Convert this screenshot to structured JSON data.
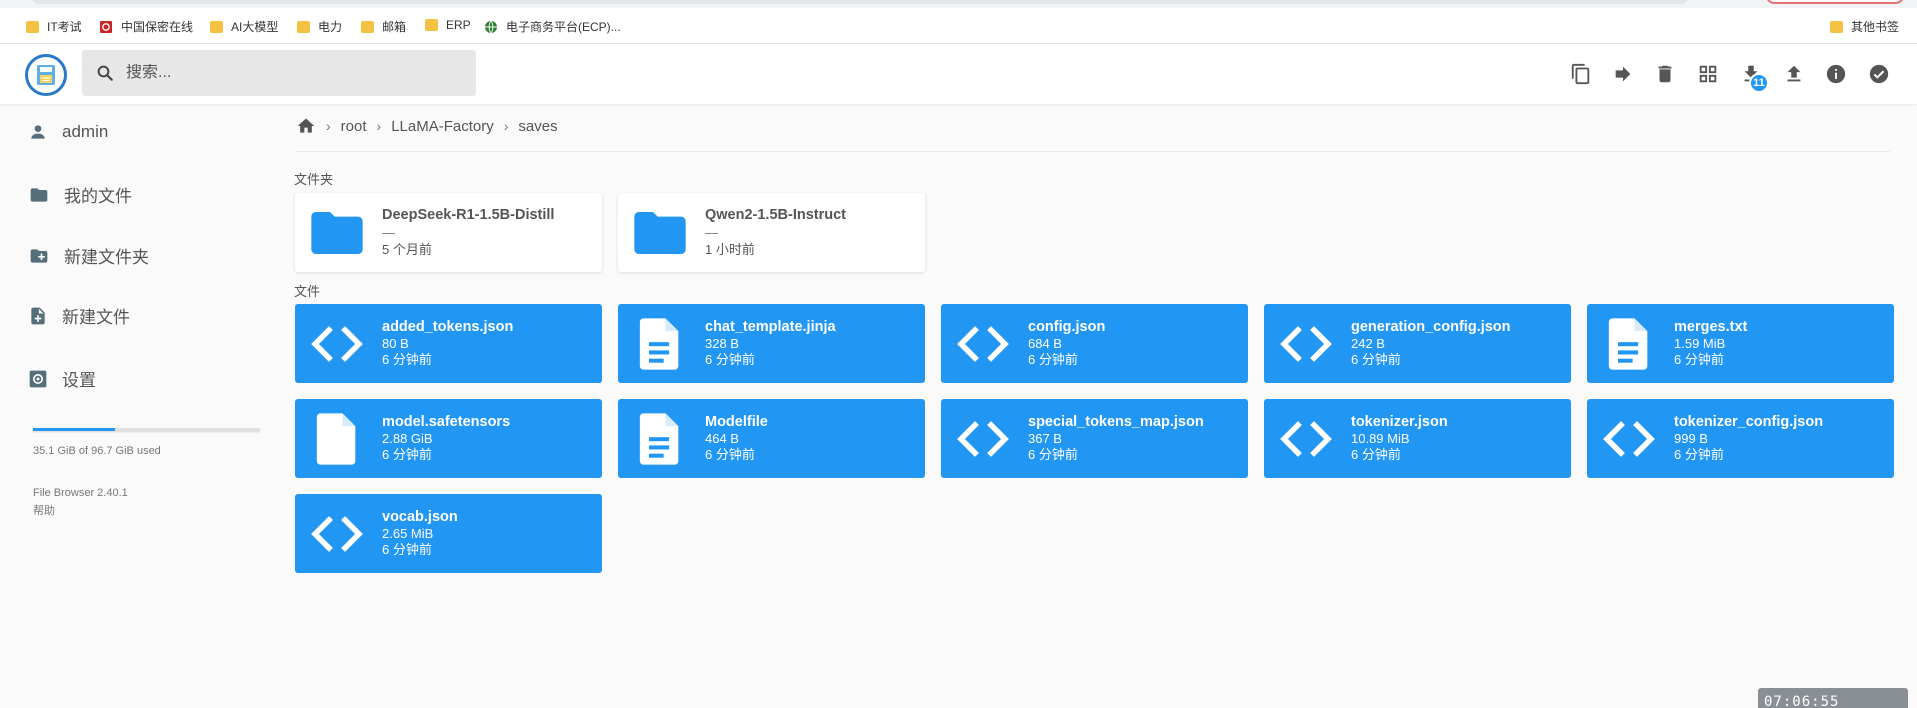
{
  "bookmarks": {
    "items": [
      {
        "label": "IT考试",
        "icon": "folder-icon"
      },
      {
        "label": "中国保密在线",
        "icon": "site-icon"
      },
      {
        "label": "AI大模型",
        "icon": "folder-icon"
      },
      {
        "label": "电力",
        "icon": "folder-icon"
      },
      {
        "label": "邮箱",
        "icon": "folder-icon"
      },
      {
        "label": "ERP",
        "icon": "folder-icon"
      },
      {
        "label": "电子商务平台(ECP)...",
        "icon": "globe-icon"
      }
    ],
    "other": "其他书签"
  },
  "header": {
    "search_placeholder": "搜索...",
    "download_badge": "11",
    "accent": "#2196f3"
  },
  "sidebar": {
    "user": "admin",
    "my_files": "我的文件",
    "new_folder": "新建文件夹",
    "new_file": "新建文件",
    "settings": "设置",
    "usage_text": "35.1 GiB of 96.7 GiB used",
    "usage_fraction": 0.363,
    "version": "File Browser 2.40.1",
    "help": "帮助"
  },
  "breadcrumb": [
    "root",
    "LLaMA-Factory",
    "saves"
  ],
  "sections": {
    "folders": "文件夹",
    "files": "文件"
  },
  "folders": [
    {
      "name": "DeepSeek-R1-1.5B-Distill",
      "size": "—",
      "date": "5 个月前"
    },
    {
      "name": "Qwen2-1.5B-Instruct",
      "size": "—",
      "date": "1 小时前"
    }
  ],
  "files": [
    {
      "name": "added_tokens.json",
      "size": "80 B",
      "date": "6 分钟前",
      "icon": "code-icon"
    },
    {
      "name": "chat_template.jinja",
      "size": "328 B",
      "date": "6 分钟前",
      "icon": "document-icon"
    },
    {
      "name": "config.json",
      "size": "684 B",
      "date": "6 分钟前",
      "icon": "code-icon"
    },
    {
      "name": "generation_config.json",
      "size": "242 B",
      "date": "6 分钟前",
      "icon": "code-icon"
    },
    {
      "name": "merges.txt",
      "size": "1.59 MiB",
      "date": "6 分钟前",
      "icon": "document-icon"
    },
    {
      "name": "model.safetensors",
      "size": "2.88 GiB",
      "date": "6 分钟前",
      "icon": "blank-file-icon"
    },
    {
      "name": "Modelfile",
      "size": "464 B",
      "date": "6 分钟前",
      "icon": "document-icon"
    },
    {
      "name": "special_tokens_map.json",
      "size": "367 B",
      "date": "6 分钟前",
      "icon": "code-icon"
    },
    {
      "name": "tokenizer.json",
      "size": "10.89 MiB",
      "date": "6 分钟前",
      "icon": "code-icon"
    },
    {
      "name": "tokenizer_config.json",
      "size": "999 B",
      "date": "6 分钟前",
      "icon": "code-icon"
    },
    {
      "name": "vocab.json",
      "size": "2.65 MiB",
      "date": "6 分钟前",
      "icon": "code-icon"
    }
  ],
  "clock": "07:06:55"
}
